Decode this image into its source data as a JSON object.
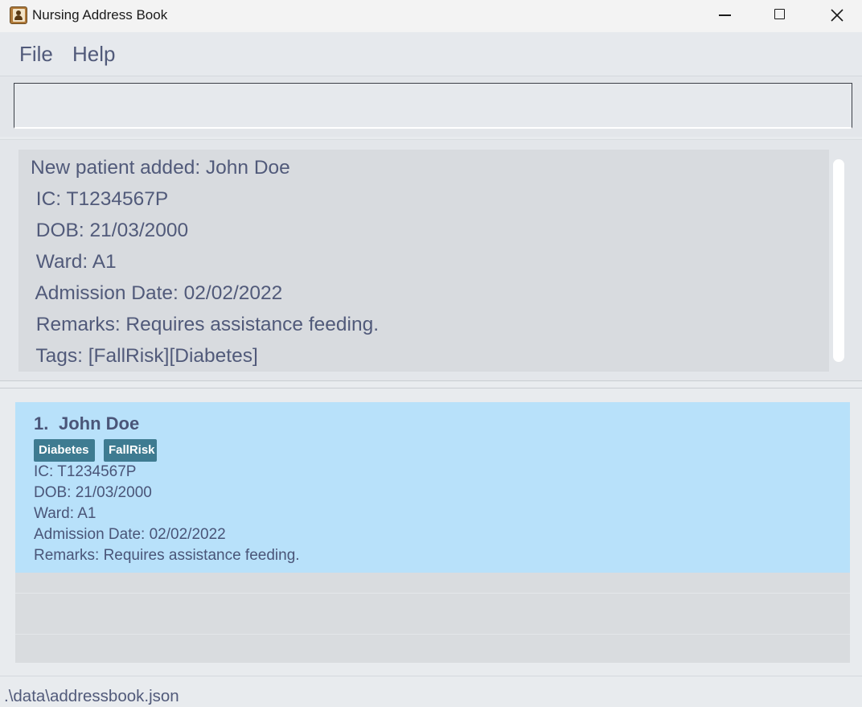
{
  "window": {
    "title": "Nursing Address Book",
    "icon": "address-book-icon",
    "controls": [
      "minimize-icon",
      "maximize-icon",
      "close-icon"
    ]
  },
  "menu": {
    "file_label": "File",
    "help_label": "Help"
  },
  "command_box": {
    "value": "",
    "placeholder": ""
  },
  "result": {
    "lines": [
      "New patient added: John Doe",
      " IC: T1234567P",
      " DOB: 21/03/2000",
      " Ward: A1",
      " Admission Date: 02/02/2022",
      " Remarks: Requires assistance feeding.",
      " Tags: [FallRisk][Diabetes]"
    ]
  },
  "patients": [
    {
      "index": "1.",
      "name": "John Doe",
      "tags": [
        "Diabetes",
        "FallRisk"
      ],
      "ic": "IC: T1234567P",
      "dob": "DOB: 21/03/2000",
      "ward": "Ward: A1",
      "admission": "Admission Date: 02/02/2022",
      "remarks": "Remarks: Requires assistance feeding."
    }
  ],
  "status_bar": {
    "path": ".\\data\\addressbook.json"
  },
  "colors": {
    "text": "#515a7a",
    "selected_card": "#b8e1fa",
    "tag_bg": "#3e7b91",
    "panel_bg": "#d8dbdf"
  }
}
